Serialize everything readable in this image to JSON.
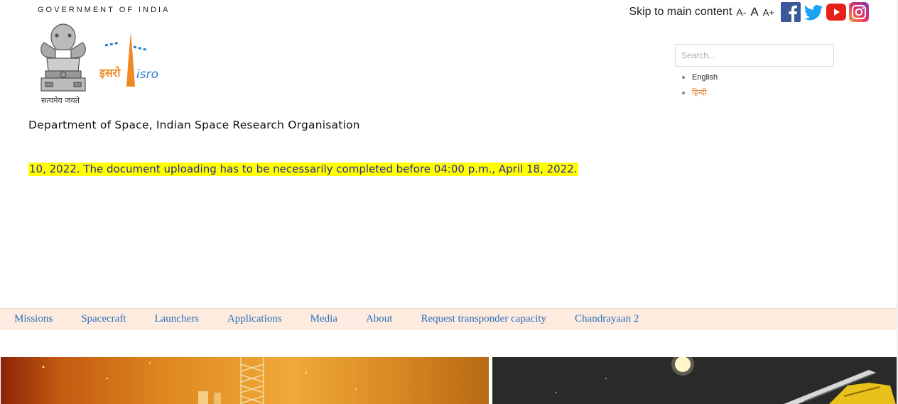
{
  "header": {
    "gov_title": "GOVERNMENT OF INDIA",
    "emblem_motto": "सत्यमेव जयते",
    "isro_logo": {
      "hindi_text": "इसरो",
      "english_text": "isro",
      "color_orange": "#f08a24",
      "color_blue": "#2a80c8"
    },
    "org_name": "Department of Space, Indian Space Research Organisation",
    "notice": "10, 2022. The document uploading has to be necessarily completed before 04:00 p.m., April 18, 2022."
  },
  "top_bar": {
    "skip_link": "Skip to main content",
    "font_decrease": "A-",
    "font_normal": "A",
    "font_increase": "A+",
    "social": [
      {
        "name": "facebook-icon",
        "color": "#3b5998"
      },
      {
        "name": "twitter-icon",
        "color": "#1da1f2"
      },
      {
        "name": "youtube-icon",
        "color": "#e62117"
      },
      {
        "name": "instagram-icon",
        "color": "#c13584"
      }
    ]
  },
  "search": {
    "placeholder": "Search..."
  },
  "languages": [
    {
      "label": "English"
    },
    {
      "label": "हिन्दी"
    }
  ],
  "nav": {
    "items": [
      {
        "label": "Missions"
      },
      {
        "label": "Spacecraft"
      },
      {
        "label": "Launchers"
      },
      {
        "label": "Applications"
      },
      {
        "label": "Media"
      },
      {
        "label": "About"
      },
      {
        "label": "Request transponder capacity"
      },
      {
        "label": "Chandrayaan 2"
      }
    ],
    "background": "#fdebe0",
    "link_color": "#2a6fb8"
  }
}
